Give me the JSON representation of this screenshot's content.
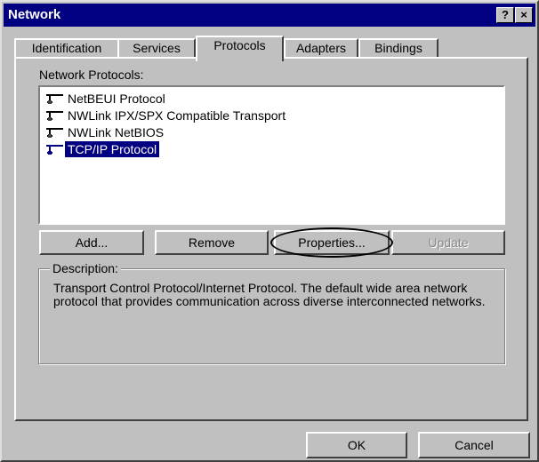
{
  "window": {
    "title": "Network",
    "help_glyph": "?",
    "close_glyph": "×"
  },
  "tabs": [
    {
      "label": "Identification",
      "active": false
    },
    {
      "label": "Services",
      "active": false
    },
    {
      "label": "Protocols",
      "active": true
    },
    {
      "label": "Adapters",
      "active": false
    },
    {
      "label": "Bindings",
      "active": false
    }
  ],
  "protocols": {
    "label": "Network Protocols:",
    "items": [
      {
        "label": "NetBEUI Protocol",
        "selected": false,
        "icon": "network-protocol-icon"
      },
      {
        "label": "NWLink IPX/SPX Compatible Transport",
        "selected": false,
        "icon": "network-protocol-icon"
      },
      {
        "label": "NWLink NetBIOS",
        "selected": false,
        "icon": "network-protocol-icon"
      },
      {
        "label": "TCP/IP Protocol",
        "selected": true,
        "icon": "network-protocol-icon"
      }
    ]
  },
  "buttons": {
    "add": "Add...",
    "remove": "Remove",
    "properties": "Properties...",
    "update": "Update"
  },
  "description": {
    "label": "Description:",
    "text": "Transport Control Protocol/Internet Protocol. The default wide area network protocol that provides communication across diverse interconnected networks."
  },
  "footer": {
    "ok": "OK",
    "cancel": "Cancel"
  },
  "colors": {
    "title_bar": "#000080",
    "selection": "#000080",
    "face": "#c0c0c0"
  }
}
